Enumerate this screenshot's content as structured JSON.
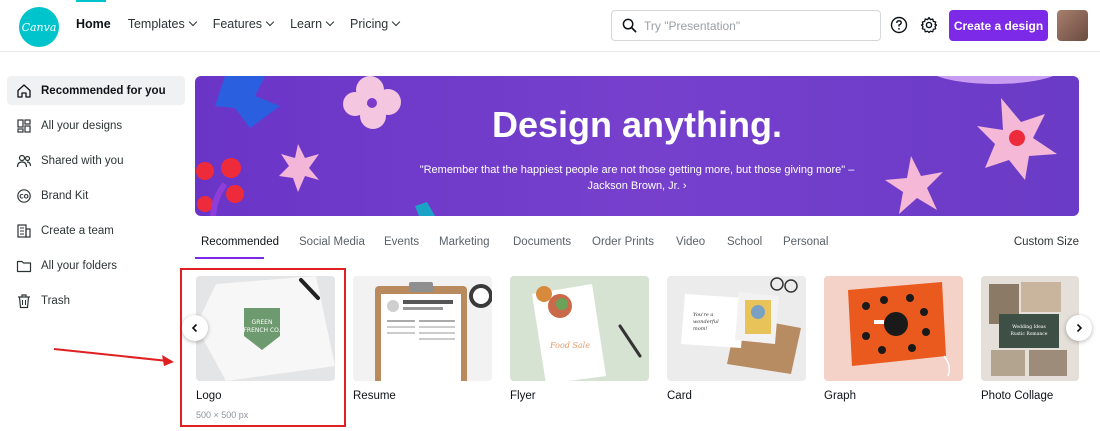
{
  "header": {
    "logo_text": "Canva",
    "nav": [
      {
        "label": "Home",
        "dropdown": false
      },
      {
        "label": "Templates",
        "dropdown": true
      },
      {
        "label": "Features",
        "dropdown": true
      },
      {
        "label": "Learn",
        "dropdown": true
      },
      {
        "label": "Pricing",
        "dropdown": true
      }
    ],
    "search_placeholder": "Try \"Presentation\"",
    "create_label": "Create a design",
    "accent": "#7d2ae8",
    "brand": "#00c4cc"
  },
  "sidebar": {
    "items": [
      {
        "label": "Recommended for you",
        "icon": "home-icon",
        "active": true
      },
      {
        "label": "All your designs",
        "icon": "grid-icon",
        "active": false
      },
      {
        "label": "Shared with you",
        "icon": "users-icon",
        "active": false
      },
      {
        "label": "Brand Kit",
        "icon": "brand-kit-icon",
        "active": false
      },
      {
        "label": "Create a team",
        "icon": "team-icon",
        "active": false
      },
      {
        "label": "All your folders",
        "icon": "folder-icon",
        "active": false
      },
      {
        "label": "Trash",
        "icon": "trash-icon",
        "active": false
      }
    ]
  },
  "banner": {
    "title": "Design anything.",
    "quote": "\"Remember that the happiest people are not those getting more, but those giving more\" –",
    "author": "Jackson Brown, Jr. ›"
  },
  "tabs": {
    "items": [
      "Recommended",
      "Social Media",
      "Events",
      "Marketing",
      "Documents",
      "Order Prints",
      "Video",
      "School",
      "Personal"
    ],
    "active": "Recommended",
    "custom_size": "Custom Size"
  },
  "cards": [
    {
      "label": "Logo",
      "sub": "500 × 500 px",
      "logo_text": "GREEN FRENCH CO."
    },
    {
      "label": "Resume",
      "sub": "",
      "name": "JACQUELINE THOMPSON"
    },
    {
      "label": "Flyer",
      "sub": "",
      "text": "Food Sale"
    },
    {
      "label": "Card",
      "sub": "",
      "text": "You're a wonderful mom!"
    },
    {
      "label": "Graph",
      "sub": ""
    },
    {
      "label": "Photo Collage",
      "sub": "",
      "text": "Wedding Ideas Rustic Romance"
    }
  ]
}
